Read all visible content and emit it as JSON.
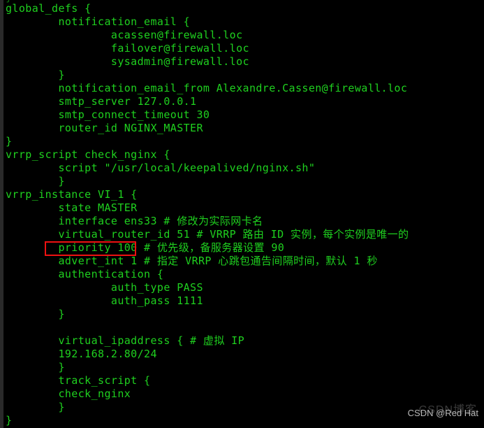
{
  "terminal": {
    "background_color": "#000000",
    "text_color": "#1fd11f",
    "border_color": "#2a2a2a",
    "clipped_top_line": "}",
    "lines": [
      "global_defs {",
      "        notification_email {",
      "                acassen@firewall.loc",
      "                failover@firewall.loc",
      "                sysadmin@firewall.loc",
      "        }",
      "        notification_email_from Alexandre.Cassen@firewall.loc",
      "        smtp_server 127.0.0.1",
      "        smtp_connect_timeout 30",
      "        router_id NGINX_MASTER",
      "}",
      "vrrp_script check_nginx {",
      "        script \"/usr/local/keepalived/nginx.sh\"",
      "        }",
      "vrrp_instance VI_1 {",
      "        state MASTER",
      "        interface ens33 # 修改为实际网卡名",
      "        virtual_router_id 51 # VRRP 路由 ID 实例，每个实例是唯一的",
      "        priority 100 # 优先级，备服务器设置 90",
      "        advert_int 1 # 指定 VRRP 心跳包通告间隔时间，默认 1 秒",
      "        authentication {",
      "                auth_type PASS",
      "                auth_pass 1111",
      "        }",
      "",
      "        virtual_ipaddress { # 虚拟 IP",
      "        192.168.2.80/24",
      "        }",
      "        track_script {",
      "        check_nginx",
      "        }",
      "}"
    ]
  },
  "annotation": {
    "highlight_label": "priority 100",
    "highlight_color": "#ee1111"
  },
  "watermark": {
    "text": "CSDN @Red Hat",
    "ghost_text": "CSDN博客",
    "color": "#b9b9b9"
  }
}
